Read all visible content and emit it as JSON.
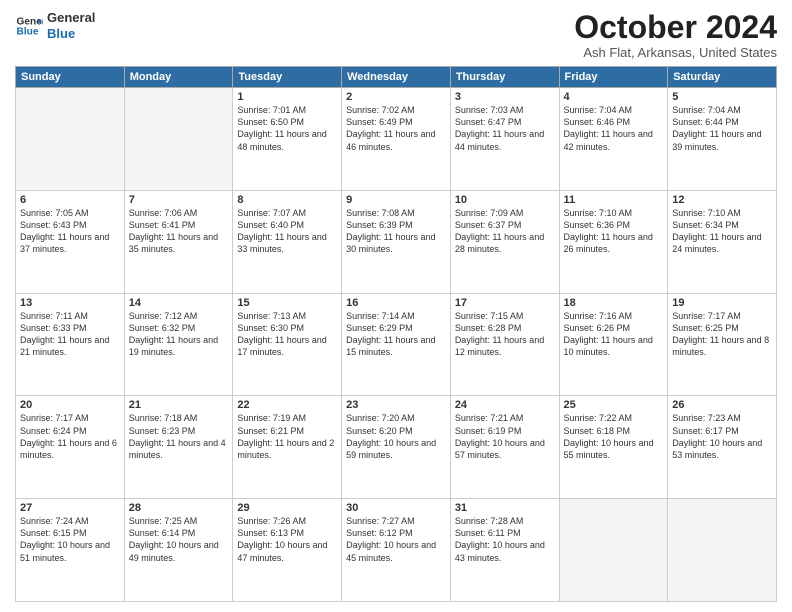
{
  "header": {
    "logo_line1": "General",
    "logo_line2": "Blue",
    "month_title": "October 2024",
    "location": "Ash Flat, Arkansas, United States"
  },
  "days_of_week": [
    "Sunday",
    "Monday",
    "Tuesday",
    "Wednesday",
    "Thursday",
    "Friday",
    "Saturday"
  ],
  "weeks": [
    [
      {
        "day": "",
        "sunrise": "",
        "sunset": "",
        "daylight": ""
      },
      {
        "day": "",
        "sunrise": "",
        "sunset": "",
        "daylight": ""
      },
      {
        "day": "1",
        "sunrise": "Sunrise: 7:01 AM",
        "sunset": "Sunset: 6:50 PM",
        "daylight": "Daylight: 11 hours and 48 minutes."
      },
      {
        "day": "2",
        "sunrise": "Sunrise: 7:02 AM",
        "sunset": "Sunset: 6:49 PM",
        "daylight": "Daylight: 11 hours and 46 minutes."
      },
      {
        "day": "3",
        "sunrise": "Sunrise: 7:03 AM",
        "sunset": "Sunset: 6:47 PM",
        "daylight": "Daylight: 11 hours and 44 minutes."
      },
      {
        "day": "4",
        "sunrise": "Sunrise: 7:04 AM",
        "sunset": "Sunset: 6:46 PM",
        "daylight": "Daylight: 11 hours and 42 minutes."
      },
      {
        "day": "5",
        "sunrise": "Sunrise: 7:04 AM",
        "sunset": "Sunset: 6:44 PM",
        "daylight": "Daylight: 11 hours and 39 minutes."
      }
    ],
    [
      {
        "day": "6",
        "sunrise": "Sunrise: 7:05 AM",
        "sunset": "Sunset: 6:43 PM",
        "daylight": "Daylight: 11 hours and 37 minutes."
      },
      {
        "day": "7",
        "sunrise": "Sunrise: 7:06 AM",
        "sunset": "Sunset: 6:41 PM",
        "daylight": "Daylight: 11 hours and 35 minutes."
      },
      {
        "day": "8",
        "sunrise": "Sunrise: 7:07 AM",
        "sunset": "Sunset: 6:40 PM",
        "daylight": "Daylight: 11 hours and 33 minutes."
      },
      {
        "day": "9",
        "sunrise": "Sunrise: 7:08 AM",
        "sunset": "Sunset: 6:39 PM",
        "daylight": "Daylight: 11 hours and 30 minutes."
      },
      {
        "day": "10",
        "sunrise": "Sunrise: 7:09 AM",
        "sunset": "Sunset: 6:37 PM",
        "daylight": "Daylight: 11 hours and 28 minutes."
      },
      {
        "day": "11",
        "sunrise": "Sunrise: 7:10 AM",
        "sunset": "Sunset: 6:36 PM",
        "daylight": "Daylight: 11 hours and 26 minutes."
      },
      {
        "day": "12",
        "sunrise": "Sunrise: 7:10 AM",
        "sunset": "Sunset: 6:34 PM",
        "daylight": "Daylight: 11 hours and 24 minutes."
      }
    ],
    [
      {
        "day": "13",
        "sunrise": "Sunrise: 7:11 AM",
        "sunset": "Sunset: 6:33 PM",
        "daylight": "Daylight: 11 hours and 21 minutes."
      },
      {
        "day": "14",
        "sunrise": "Sunrise: 7:12 AM",
        "sunset": "Sunset: 6:32 PM",
        "daylight": "Daylight: 11 hours and 19 minutes."
      },
      {
        "day": "15",
        "sunrise": "Sunrise: 7:13 AM",
        "sunset": "Sunset: 6:30 PM",
        "daylight": "Daylight: 11 hours and 17 minutes."
      },
      {
        "day": "16",
        "sunrise": "Sunrise: 7:14 AM",
        "sunset": "Sunset: 6:29 PM",
        "daylight": "Daylight: 11 hours and 15 minutes."
      },
      {
        "day": "17",
        "sunrise": "Sunrise: 7:15 AM",
        "sunset": "Sunset: 6:28 PM",
        "daylight": "Daylight: 11 hours and 12 minutes."
      },
      {
        "day": "18",
        "sunrise": "Sunrise: 7:16 AM",
        "sunset": "Sunset: 6:26 PM",
        "daylight": "Daylight: 11 hours and 10 minutes."
      },
      {
        "day": "19",
        "sunrise": "Sunrise: 7:17 AM",
        "sunset": "Sunset: 6:25 PM",
        "daylight": "Daylight: 11 hours and 8 minutes."
      }
    ],
    [
      {
        "day": "20",
        "sunrise": "Sunrise: 7:17 AM",
        "sunset": "Sunset: 6:24 PM",
        "daylight": "Daylight: 11 hours and 6 minutes."
      },
      {
        "day": "21",
        "sunrise": "Sunrise: 7:18 AM",
        "sunset": "Sunset: 6:23 PM",
        "daylight": "Daylight: 11 hours and 4 minutes."
      },
      {
        "day": "22",
        "sunrise": "Sunrise: 7:19 AM",
        "sunset": "Sunset: 6:21 PM",
        "daylight": "Daylight: 11 hours and 2 minutes."
      },
      {
        "day": "23",
        "sunrise": "Sunrise: 7:20 AM",
        "sunset": "Sunset: 6:20 PM",
        "daylight": "Daylight: 10 hours and 59 minutes."
      },
      {
        "day": "24",
        "sunrise": "Sunrise: 7:21 AM",
        "sunset": "Sunset: 6:19 PM",
        "daylight": "Daylight: 10 hours and 57 minutes."
      },
      {
        "day": "25",
        "sunrise": "Sunrise: 7:22 AM",
        "sunset": "Sunset: 6:18 PM",
        "daylight": "Daylight: 10 hours and 55 minutes."
      },
      {
        "day": "26",
        "sunrise": "Sunrise: 7:23 AM",
        "sunset": "Sunset: 6:17 PM",
        "daylight": "Daylight: 10 hours and 53 minutes."
      }
    ],
    [
      {
        "day": "27",
        "sunrise": "Sunrise: 7:24 AM",
        "sunset": "Sunset: 6:15 PM",
        "daylight": "Daylight: 10 hours and 51 minutes."
      },
      {
        "day": "28",
        "sunrise": "Sunrise: 7:25 AM",
        "sunset": "Sunset: 6:14 PM",
        "daylight": "Daylight: 10 hours and 49 minutes."
      },
      {
        "day": "29",
        "sunrise": "Sunrise: 7:26 AM",
        "sunset": "Sunset: 6:13 PM",
        "daylight": "Daylight: 10 hours and 47 minutes."
      },
      {
        "day": "30",
        "sunrise": "Sunrise: 7:27 AM",
        "sunset": "Sunset: 6:12 PM",
        "daylight": "Daylight: 10 hours and 45 minutes."
      },
      {
        "day": "31",
        "sunrise": "Sunrise: 7:28 AM",
        "sunset": "Sunset: 6:11 PM",
        "daylight": "Daylight: 10 hours and 43 minutes."
      },
      {
        "day": "",
        "sunrise": "",
        "sunset": "",
        "daylight": ""
      },
      {
        "day": "",
        "sunrise": "",
        "sunset": "",
        "daylight": ""
      }
    ]
  ]
}
